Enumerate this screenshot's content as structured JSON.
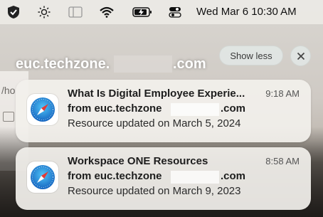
{
  "menubar": {
    "icons": [
      "vpn-shield-icon",
      "brightness-icon",
      "sidebar-window-icon",
      "wifi-icon",
      "battery-charging-icon",
      "control-center-icon"
    ],
    "clock": "Wed Mar 6  10:30 AM"
  },
  "background": {
    "hint_text": "/ho"
  },
  "notification_group": {
    "title": "euc.techzone.",
    "title_suffix": ".com",
    "show_less_label": "Show less",
    "close_label": "×"
  },
  "notifications": [
    {
      "app_icon": "safari-icon",
      "title": "What Is Digital Employee Experie...",
      "time": "9:18 AM",
      "from": "from euc.techzone",
      "from_suffix": ".com",
      "body": "Resource updated on March 5, 2024"
    },
    {
      "app_icon": "safari-icon",
      "title": "Workspace ONE Resources",
      "time": "8:58 AM",
      "from": "from euc.techzone",
      "from_suffix": ".com",
      "body": "Resource updated on March 9, 2023"
    }
  ]
}
